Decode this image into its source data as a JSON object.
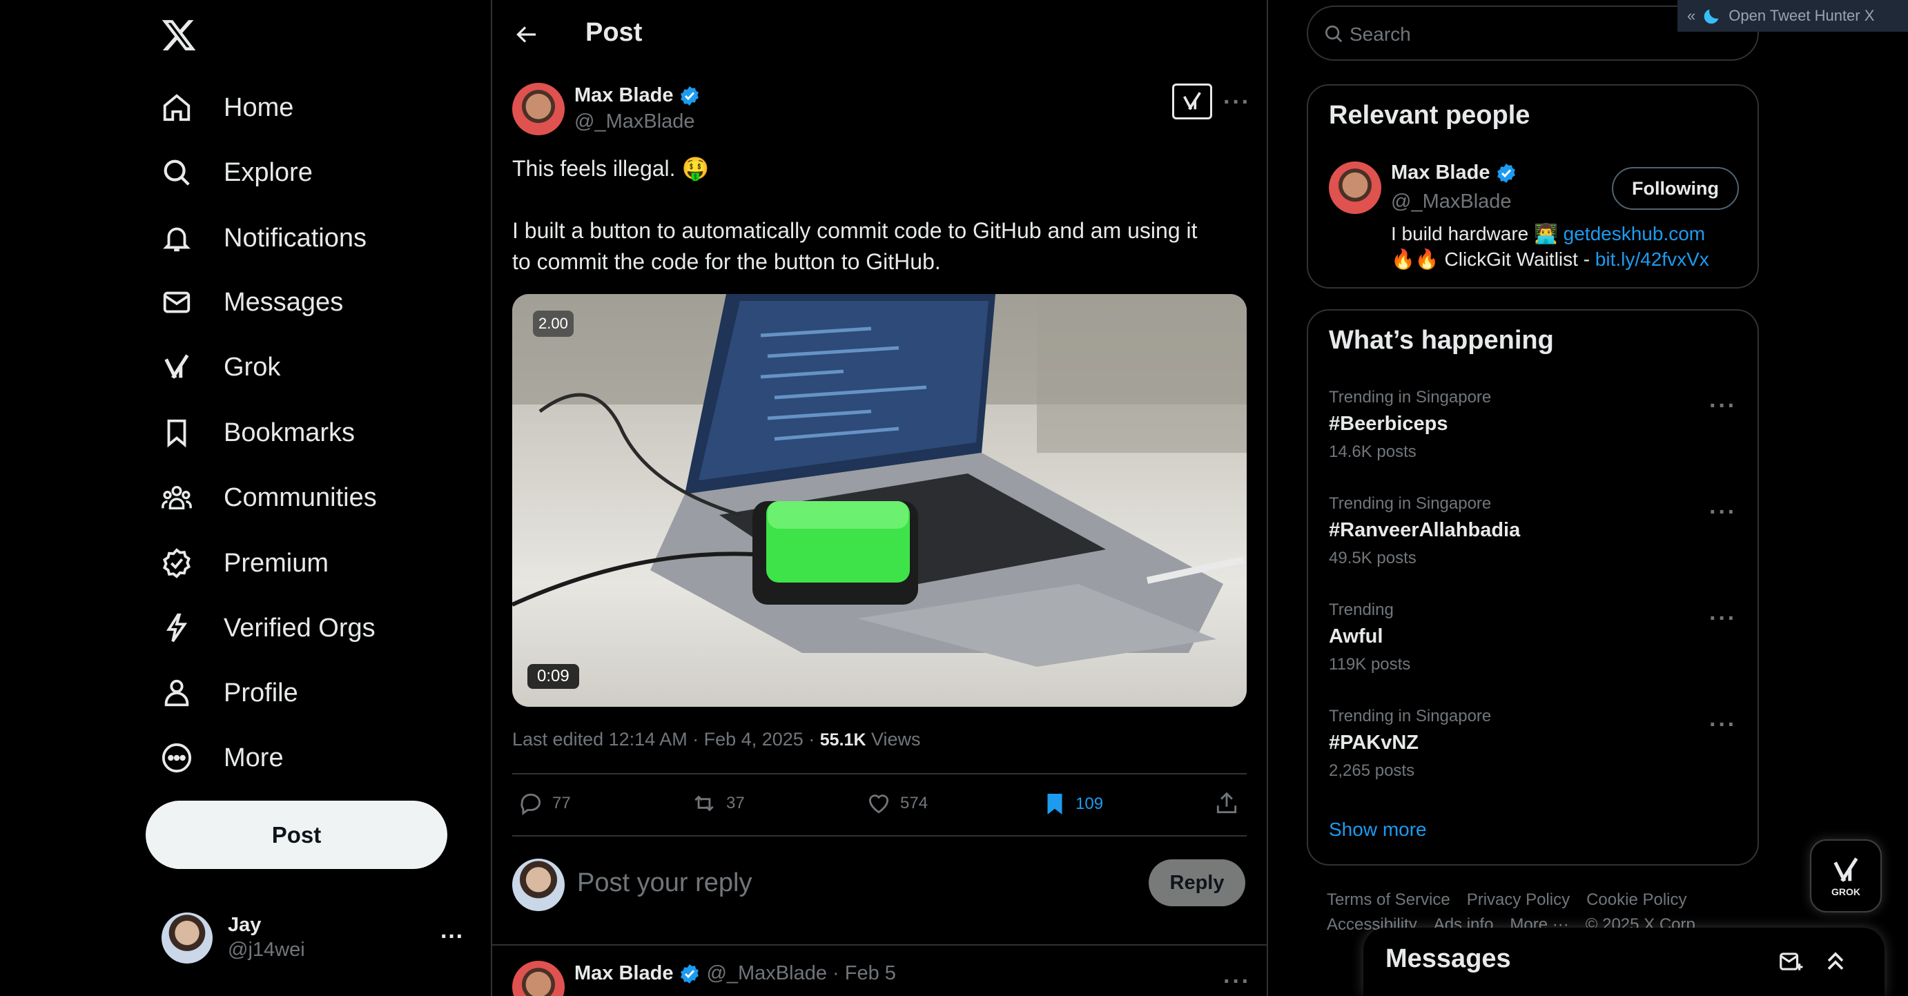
{
  "nav": {
    "items": [
      {
        "label": "Home",
        "icon": "home-icon"
      },
      {
        "label": "Explore",
        "icon": "search-icon"
      },
      {
        "label": "Notifications",
        "icon": "bell-icon"
      },
      {
        "label": "Messages",
        "icon": "mail-icon"
      },
      {
        "label": "Grok",
        "icon": "grok-icon"
      },
      {
        "label": "Bookmarks",
        "icon": "bookmark-icon"
      },
      {
        "label": "Communities",
        "icon": "communities-icon"
      },
      {
        "label": "Premium",
        "icon": "verified-badge-icon"
      },
      {
        "label": "Verified Orgs",
        "icon": "lightning-icon"
      },
      {
        "label": "Profile",
        "icon": "person-icon"
      },
      {
        "label": "More",
        "icon": "more-circle-icon"
      }
    ],
    "post_button": "Post",
    "account": {
      "name": "Jay",
      "handle": "@j14wei",
      "more": "···"
    }
  },
  "header": {
    "title": "Post"
  },
  "tweet": {
    "author": "Max Blade",
    "handle": "@_MaxBlade",
    "text_line1": "This feels illegal. 🤑",
    "text_line2": "I built a button to automatically commit code to GitHub and am using it",
    "text_line3": "to commit the code for the button to GitHub.",
    "video": {
      "speed": "2.00",
      "duration": "0:09"
    },
    "meta_prefix": "Last edited 12:14 AM · Feb 4, 2025 · ",
    "views_count": "55.1K",
    "views_label": " Views",
    "stats": {
      "replies": "77",
      "reposts": "37",
      "likes": "574",
      "bookmarks": "109"
    }
  },
  "reply": {
    "placeholder": "Post your reply",
    "button": "Reply"
  },
  "next_reply": {
    "author": "Max Blade",
    "handle_date": "@_MaxBlade · Feb 5"
  },
  "search": {
    "placeholder": "Search"
  },
  "extension": {
    "label": "Open Tweet Hunter X",
    "chevron": "«"
  },
  "relevant": {
    "title": "Relevant people",
    "name": "Max Blade",
    "handle": "@_MaxBlade",
    "button": "Following",
    "bio1_text": "I build hardware 👨‍💻 ",
    "bio1_link": "getdeskhub.com",
    "bio2_text": "🔥🔥 ClickGit Waitlist - ",
    "bio2_link": "bit.ly/42fvxVx"
  },
  "happening": {
    "title": "What’s happening",
    "trends": [
      {
        "context": "Trending in Singapore",
        "name": "#Beerbiceps",
        "count": "14.6K posts"
      },
      {
        "context": "Trending in Singapore",
        "name": "#RanveerAllahbadia",
        "count": "49.5K posts"
      },
      {
        "context": "Trending",
        "name": "Awful",
        "count": "119K posts"
      },
      {
        "context": "Trending in Singapore",
        "name": "#PAKvNZ",
        "count": "2,265 posts"
      }
    ],
    "show_more": "Show more"
  },
  "footer": {
    "links1": [
      "Terms of Service",
      "Privacy Policy",
      "Cookie Policy"
    ],
    "links2": [
      "Accessibility",
      "Ads info",
      "More ···",
      "© 2025 X Corp."
    ]
  },
  "grok_fab": {
    "label": "GROK"
  },
  "messages_drawer": {
    "title": "Messages"
  },
  "colors": {
    "accent": "#1d9bf0",
    "bg": "#000000",
    "border": "#2f3336",
    "muted": "#71767b"
  }
}
